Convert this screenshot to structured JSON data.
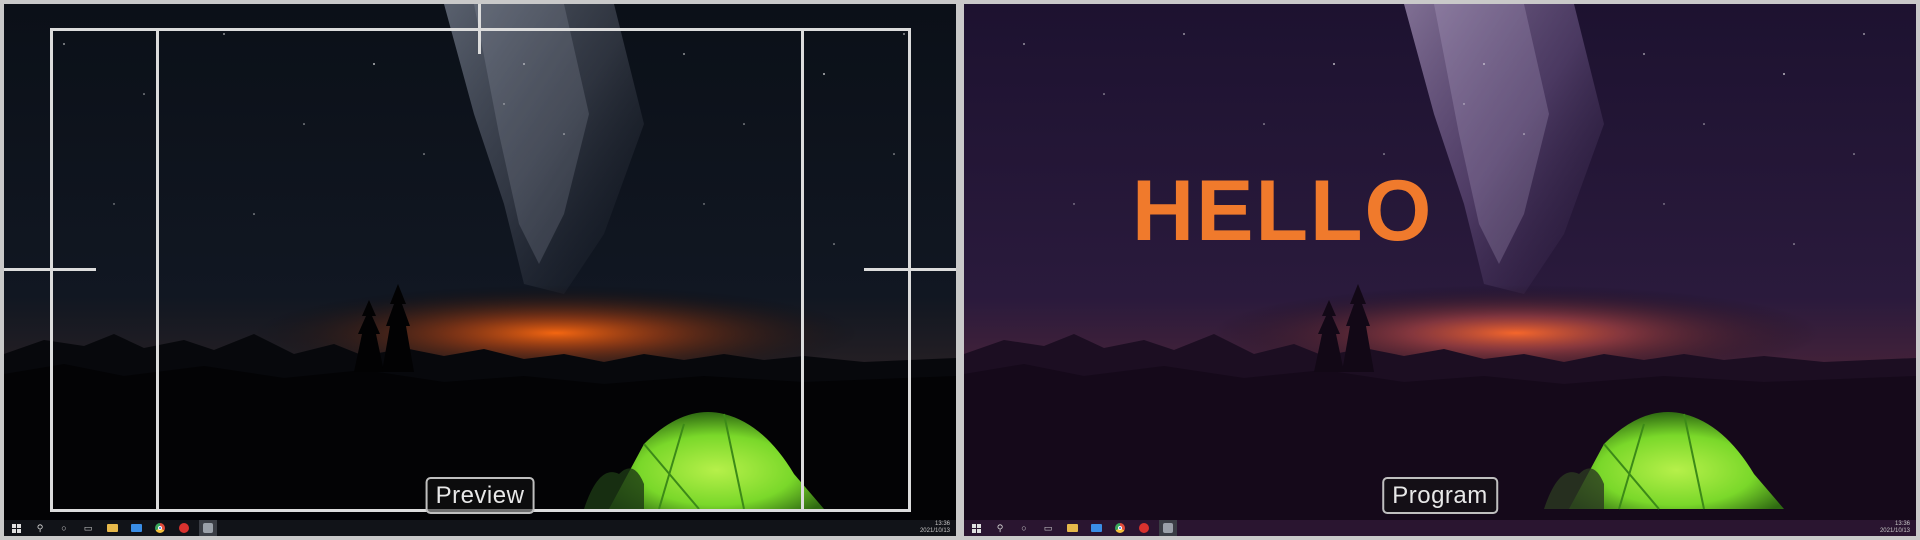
{
  "preview": {
    "label": "Preview"
  },
  "program": {
    "label": "Program",
    "overlay_title": "HELLO",
    "overlay_color": "#f07a2c"
  },
  "taskbar": {
    "icons": [
      "windows-start-icon",
      "search-icon",
      "cortana-icon",
      "task-view-icon",
      "file-explorer-icon",
      "mail-icon",
      "chrome-icon",
      "red-app-icon",
      "active-app-icon"
    ],
    "clock_time": "13:36",
    "clock_date": "2021/10/13"
  },
  "colors": {
    "guide": "#dcdcdc",
    "tent": "#8ee03a",
    "horizon_glow": "#ff6a10",
    "background": "#c9c9c9"
  }
}
